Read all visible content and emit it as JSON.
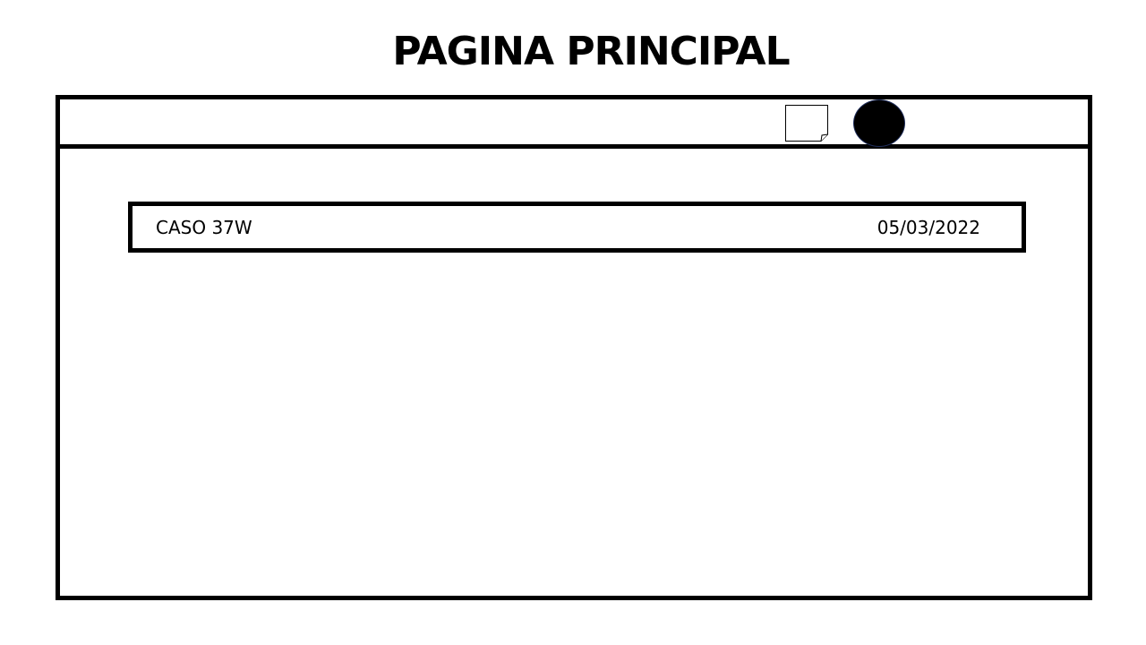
{
  "header": {
    "title": "PAGINA PRINCIPAL"
  },
  "toolbar": {
    "document_icon": "document-icon",
    "avatar_icon": "user-avatar"
  },
  "cases": [
    {
      "name": "CASO 37W",
      "date": "05/03/2022"
    }
  ],
  "colors": {
    "border": "#000000",
    "background": "#ffffff",
    "avatar_outline": "#1f2d5a"
  }
}
